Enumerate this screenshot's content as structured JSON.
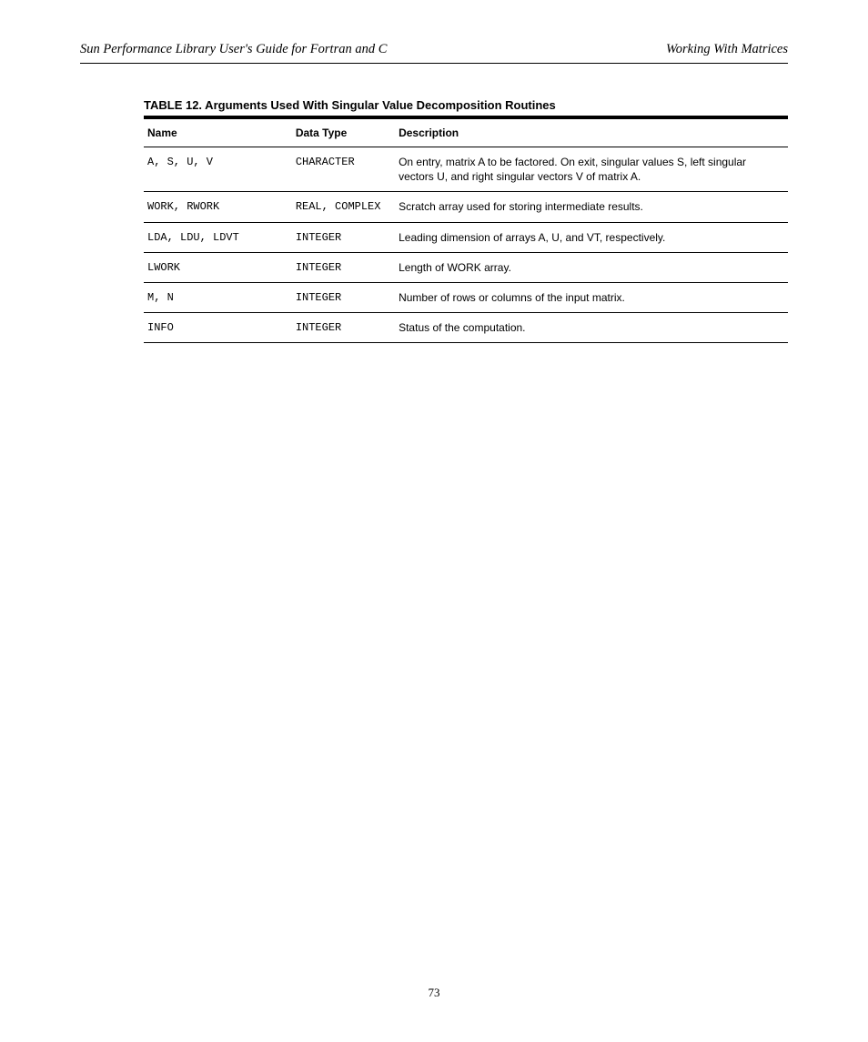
{
  "header": {
    "left": "Sun Performance Library User's Guide for Fortran and C",
    "right": "Working With Matrices"
  },
  "table": {
    "title": "TABLE 12. Arguments Used With Singular Value Decomposition Routines",
    "columns": [
      "Name",
      "Data Type",
      "Description"
    ],
    "rows": [
      {
        "name": "A, S, U, V",
        "type": "CHARACTER",
        "desc": "On entry, matrix A to be factored.\nOn exit, singular values S, left singular vectors U, and right singular vectors V of matrix A."
      },
      {
        "name": "WORK, RWORK",
        "type": "REAL, COMPLEX",
        "desc": "Scratch array used for storing intermediate results."
      },
      {
        "name": "LDA, LDU, LDVT",
        "type": "INTEGER",
        "desc": "Leading dimension of arrays A, U, and VT, respectively."
      },
      {
        "name": "LWORK",
        "type": "INTEGER",
        "desc": "Length of WORK array."
      },
      {
        "name": "M, N",
        "type": "INTEGER",
        "desc": "Number of rows or columns of the input matrix."
      },
      {
        "name": "INFO",
        "type": "INTEGER",
        "desc": "Status of the computation."
      }
    ]
  },
  "page_number": "73"
}
